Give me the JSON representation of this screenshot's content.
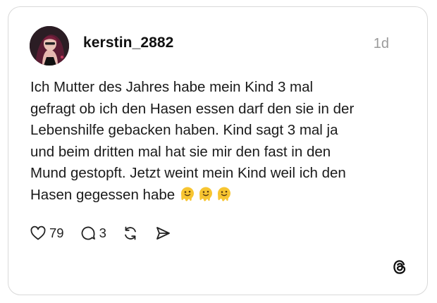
{
  "post": {
    "username": "kerstin_2882",
    "time_ago": "1d",
    "text_lines": [
      "Ich Mutter des Jahres habe mein Kind 3 mal",
      "gefragt ob ich den Hasen essen darf den sie in der",
      "Lebenshilfe gebacken haben. Kind sagt 3 mal ja",
      "und beim dritten mal hat sie mir den fast in den",
      "Mund gestopft. Jetzt weint mein Kind weil ich den",
      "Hasen gegessen habe"
    ],
    "emojis": [
      "melting-face",
      "melting-face",
      "melting-face"
    ]
  },
  "actions": {
    "likes": "79",
    "replies": "3"
  },
  "icons": {
    "like": "heart-icon",
    "reply": "comment-icon",
    "repost": "repost-icon",
    "share": "send-icon",
    "brand": "threads-logo-icon"
  },
  "colors": {
    "text": "#1a1a1a",
    "muted": "#9a9a9a",
    "border": "#d9d9d9",
    "emoji": "#f7c531"
  }
}
